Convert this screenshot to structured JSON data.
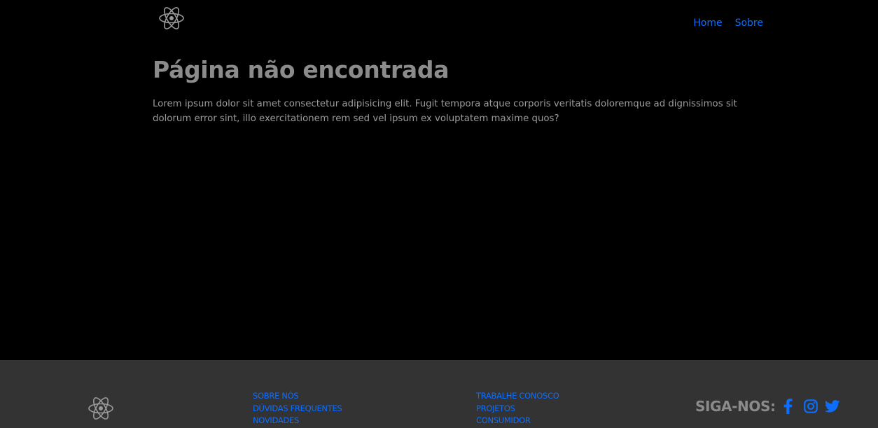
{
  "header": {
    "logo_icon": "react-atom-icon",
    "nav": [
      {
        "label": "Home"
      },
      {
        "label": "Sobre"
      }
    ]
  },
  "main": {
    "title": "Página não encontrada",
    "body": "Lorem ipsum dolor sit amet consectetur adipisicing elit. Fugit tempora atque corporis veritatis doloremque ad dignissimos sit dolorum error sint, illo exercitationem rem sed vel ipsum ex voluptatem maxime quos?"
  },
  "footer": {
    "logo_icon": "react-atom-icon",
    "column1": [
      "SOBRE NÓS",
      "DÚVIDAS FREQUENTES",
      "NOVIDADES"
    ],
    "column2": [
      "TRABALHE CONOSCO",
      "PROJETOS",
      "CONSUMIDOR"
    ],
    "social_label": "SIGA-NOS:",
    "social_icons": [
      "facebook-icon",
      "instagram-icon",
      "twitter-icon"
    ]
  },
  "colors": {
    "background": "#000000",
    "footer_background": "#333333",
    "link": "#0d6efd",
    "text_muted": "#8b8b8b"
  }
}
